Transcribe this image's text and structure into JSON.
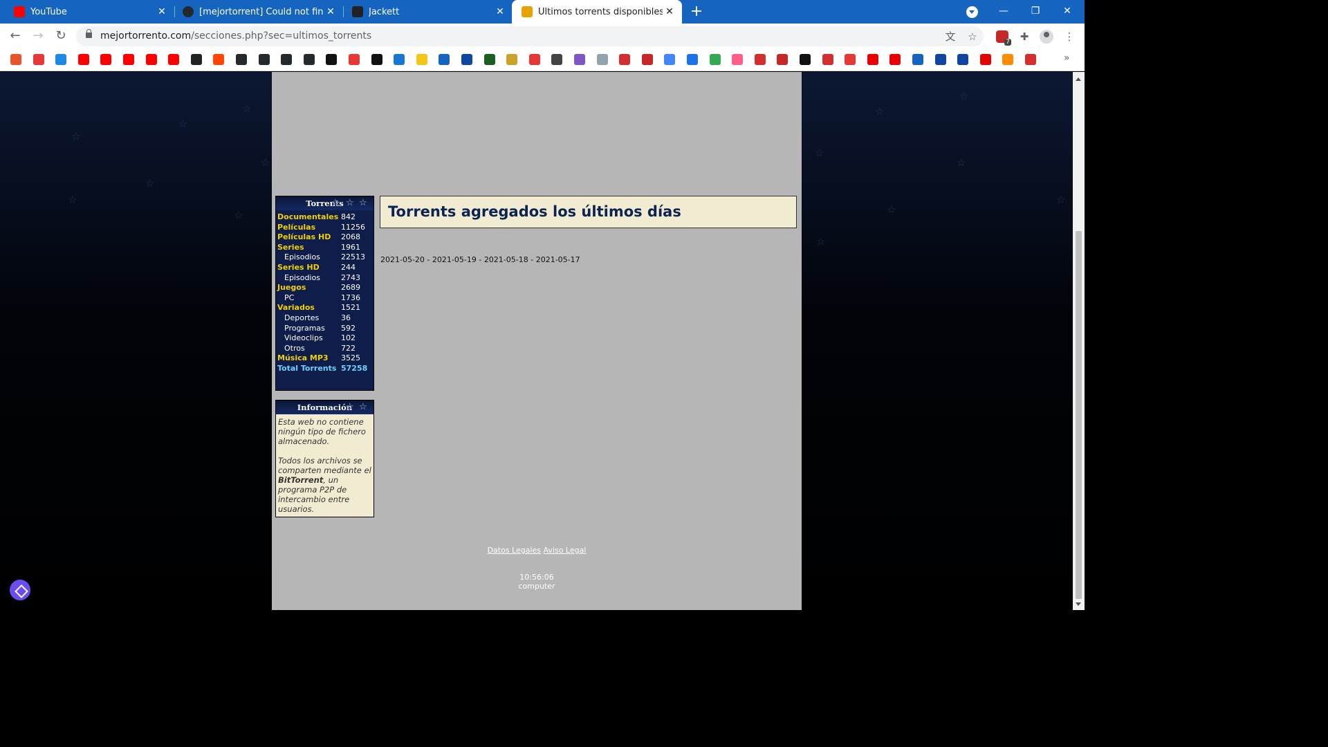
{
  "browser": {
    "tabs": [
      {
        "title": "YouTube",
        "favicon": "youtube-icon",
        "color": "#ff0000"
      },
      {
        "title": "[mejortorrent] Could not find rele",
        "favicon": "github-icon",
        "color": "#24292e"
      },
      {
        "title": "Jackett",
        "favicon": "jackett-icon",
        "color": "#222222"
      },
      {
        "title": "Últimos torrents disponibles",
        "favicon": "mejortorrent-icon",
        "color": "#e8a200",
        "active": true
      }
    ],
    "new_tab": "+",
    "window_controls": {
      "minimize": "—",
      "restore": "❐",
      "close": "✕"
    },
    "url_host": "mejortorrento.com",
    "url_path": "/secciones.php?sec=ultimos_torrents",
    "extension_badge": "7",
    "bookmarks_more": "»",
    "accent": "#1565c0"
  },
  "sidebar": {
    "torrents": {
      "title": "Torrents",
      "rows": [
        {
          "name": "Documentales",
          "count": "842",
          "level": "main"
        },
        {
          "name": "Películas",
          "count": "11256",
          "level": "main"
        },
        {
          "name": "Películas HD",
          "count": "2068",
          "level": "main"
        },
        {
          "name": "Series",
          "count": "1961",
          "level": "main"
        },
        {
          "name": "Episodios",
          "count": "22513",
          "level": "sub"
        },
        {
          "name": "Series HD",
          "count": "244",
          "level": "main"
        },
        {
          "name": "Episodios",
          "count": "2743",
          "level": "sub"
        },
        {
          "name": "Juegos",
          "count": "2689",
          "level": "main"
        },
        {
          "name": "PC",
          "count": "1736",
          "level": "sub"
        },
        {
          "name": "Variados",
          "count": "1521",
          "level": "main"
        },
        {
          "name": "Deportes",
          "count": "36",
          "level": "sub"
        },
        {
          "name": "Programas",
          "count": "592",
          "level": "sub"
        },
        {
          "name": "Videoclips",
          "count": "102",
          "level": "sub"
        },
        {
          "name": "Otros",
          "count": "722",
          "level": "sub"
        },
        {
          "name": "Música MP3",
          "count": "3525",
          "level": "main"
        },
        {
          "name": "Total Torrents",
          "count": "57258",
          "level": "total"
        }
      ]
    },
    "info": {
      "title": "Información",
      "para1": "Esta web no contiene ningún tipo de fichero almacenado.",
      "para2_pre": "Todos los archivos se comparten mediante el ",
      "para2_bold": "BitTorrent",
      "para2_post": ", un programa P2P de intercambio entre usuarios."
    }
  },
  "main": {
    "headline": "Torrents agregados los últimos días",
    "dates": [
      "2021-05-20",
      "2021-05-19",
      "2021-05-18",
      "2021-05-17"
    ],
    "date_separator": " - "
  },
  "footer": {
    "links": [
      "Datos Legales",
      "Aviso Legal"
    ],
    "time": "10:56:06",
    "host": "computer"
  }
}
